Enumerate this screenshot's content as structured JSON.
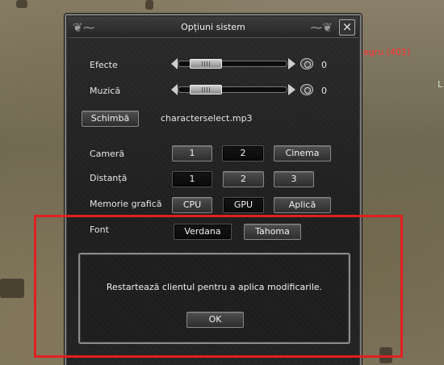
{
  "window": {
    "title": "Opțiuni sistem",
    "close_icon": "×"
  },
  "background": {
    "player_name": "egru (401)",
    "player_name_color": "#ff3030",
    "side_glyph": "L"
  },
  "audio": {
    "effects_label": "Efecte",
    "effects_value": "0",
    "effects_level": 0.15,
    "music_label": "Muzică",
    "music_value": "0",
    "music_level": 0.15,
    "change_button": "Schimbă",
    "music_file": "characterselect.mp3"
  },
  "camera": {
    "label": "Cameră",
    "options": [
      "1",
      "2",
      "Cinema"
    ],
    "selected": "2"
  },
  "distance": {
    "label": "Distanță",
    "options": [
      "1",
      "2",
      "3"
    ],
    "selected": "1"
  },
  "graphics_memory": {
    "label": "Memorie grafică",
    "options": [
      "CPU",
      "GPU"
    ],
    "selected": "GPU",
    "apply_button": "Aplică"
  },
  "font": {
    "label": "Font",
    "options": [
      "Verdana",
      "Tahoma"
    ],
    "selected": "Verdana"
  },
  "dialog": {
    "message": "Restartează clientul pentru a aplica modificarile.",
    "ok_button": "OK"
  },
  "colors": {
    "highlight": "#e02020",
    "panel": "#222222"
  }
}
